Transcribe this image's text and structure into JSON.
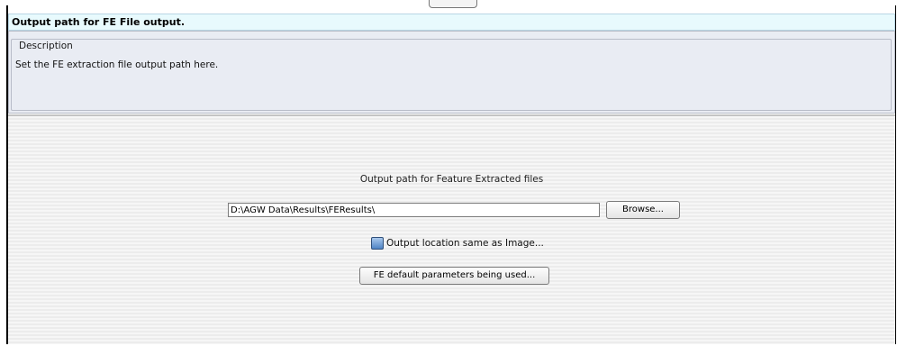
{
  "header": {
    "title": "Output path for FE File output."
  },
  "description": {
    "legend": "Description",
    "text": "Set the FE extraction file output path here."
  },
  "main": {
    "output_label": "Output path for Feature Extracted files",
    "path_value": "D:\\AGW Data\\Results\\FEResults\\",
    "browse_label": "Browse...",
    "checkbox_label": "Output location same as Image...",
    "defaults_button_label": "FE default parameters being used..."
  }
}
